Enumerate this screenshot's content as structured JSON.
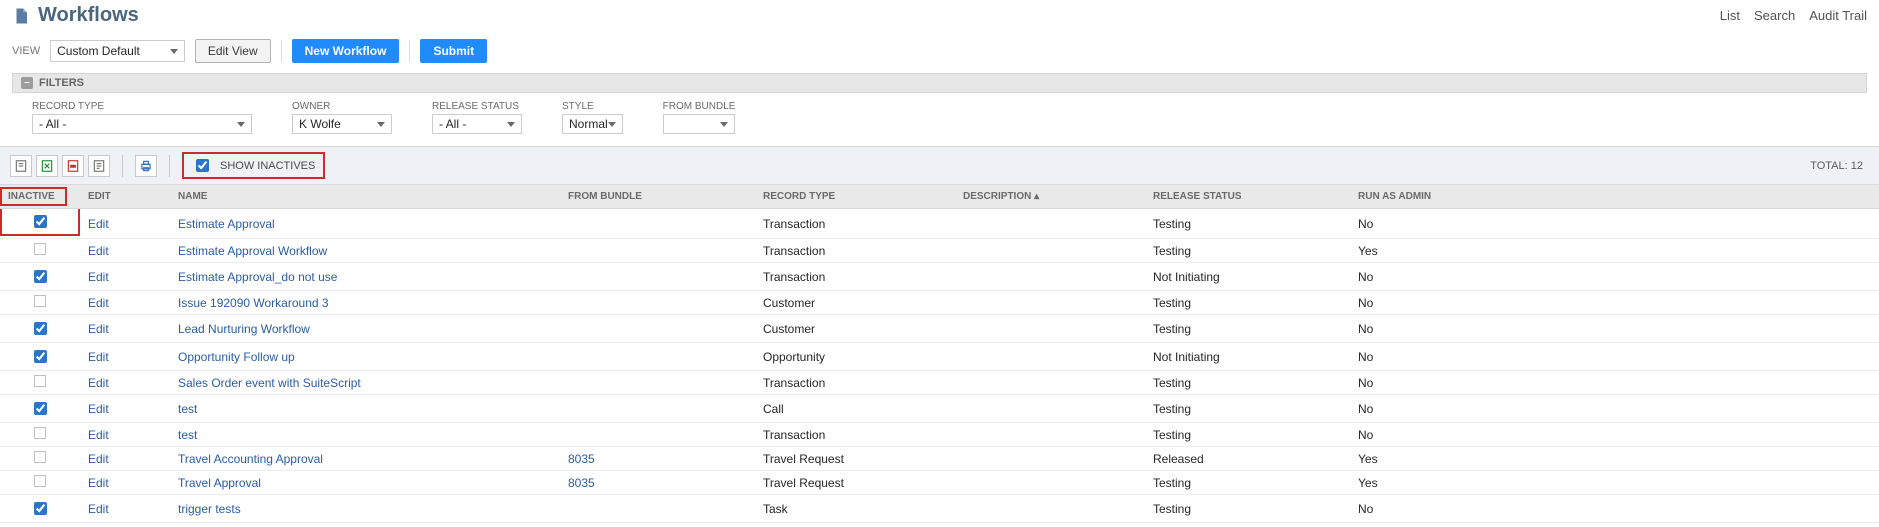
{
  "header": {
    "title": "Workflows",
    "links": [
      "List",
      "Search",
      "Audit Trail"
    ]
  },
  "view": {
    "label": "VIEW",
    "selected": "Custom Default",
    "edit_view": "Edit View",
    "new_workflow": "New Workflow",
    "submit": "Submit"
  },
  "filters": {
    "heading": "FILTERS",
    "record_type": {
      "label": "RECORD TYPE",
      "value": "- All -"
    },
    "owner": {
      "label": "OWNER",
      "value": "K Wolfe"
    },
    "release_status": {
      "label": "RELEASE STATUS",
      "value": "- All -"
    },
    "style": {
      "label": "STYLE",
      "value": "Normal"
    },
    "from_bundle": {
      "label": "FROM BUNDLE",
      "value": ""
    }
  },
  "toolbar": {
    "show_inactives": "SHOW INACTIVES",
    "total_label": "TOTAL:",
    "total_value": "12"
  },
  "columns": {
    "inactive": "INACTIVE",
    "edit": "EDIT",
    "name": "NAME",
    "from_bundle": "FROM BUNDLE",
    "record_type": "RECORD TYPE",
    "description": "DESCRIPTION ▴",
    "release_status": "RELEASE STATUS",
    "run_as_admin": "RUN AS ADMIN"
  },
  "edit_label": "Edit",
  "rows": [
    {
      "inactive": true,
      "name": "Estimate Approval",
      "bundle": "",
      "rtype": "Transaction",
      "status": "Testing",
      "admin": "No"
    },
    {
      "inactive": false,
      "name": "Estimate Approval Workflow",
      "bundle": "",
      "rtype": "Transaction",
      "status": "Testing",
      "admin": "Yes"
    },
    {
      "inactive": true,
      "name": "Estimate Approval_do not use",
      "bundle": "",
      "rtype": "Transaction",
      "status": "Not Initiating",
      "admin": "No"
    },
    {
      "inactive": false,
      "name": "Issue 192090 Workaround 3",
      "bundle": "",
      "rtype": "Customer",
      "status": "Testing",
      "admin": "No"
    },
    {
      "inactive": true,
      "name": "Lead Nurturing Workflow",
      "bundle": "",
      "rtype": "Customer",
      "status": "Testing",
      "admin": "No"
    },
    {
      "inactive": true,
      "name": "Opportunity Follow up",
      "bundle": "",
      "rtype": "Opportunity",
      "status": "Not Initiating",
      "admin": "No"
    },
    {
      "inactive": false,
      "name": "Sales Order event with SuiteScript",
      "bundle": "",
      "rtype": "Transaction",
      "status": "Testing",
      "admin": "No"
    },
    {
      "inactive": true,
      "name": "test",
      "bundle": "",
      "rtype": "Call",
      "status": "Testing",
      "admin": "No"
    },
    {
      "inactive": false,
      "name": "test",
      "bundle": "",
      "rtype": "Transaction",
      "status": "Testing",
      "admin": "No"
    },
    {
      "inactive": false,
      "name": "Travel Accounting Approval",
      "bundle": "8035",
      "rtype": "Travel Request",
      "status": "Released",
      "admin": "Yes"
    },
    {
      "inactive": false,
      "name": "Travel Approval",
      "bundle": "8035",
      "rtype": "Travel Request",
      "status": "Testing",
      "admin": "Yes"
    },
    {
      "inactive": true,
      "name": "trigger tests",
      "bundle": "",
      "rtype": "Task",
      "status": "Testing",
      "admin": "No"
    }
  ]
}
